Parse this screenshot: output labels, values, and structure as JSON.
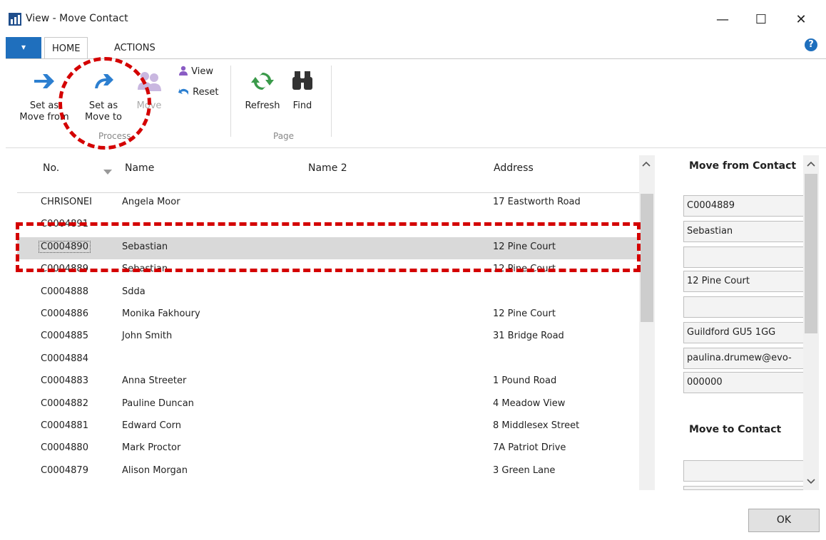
{
  "window": {
    "title": "View - Move Contact",
    "minimize_glyph": "—",
    "maximize_glyph": "☐",
    "close_glyph": "✕"
  },
  "ribbon": {
    "file_tab_glyph": "▾",
    "tabs": [
      {
        "label": "HOME"
      },
      {
        "label": "ACTIONS"
      }
    ],
    "help_glyph": "?",
    "buttons": {
      "set_move_from": "Set as\nMove from",
      "set_move_to": "Set as\nMove to",
      "move": "Move",
      "view": "View",
      "reset": "Reset",
      "refresh": "Refresh",
      "find": "Find"
    },
    "groups": {
      "process": "Process",
      "page": "Page"
    }
  },
  "grid": {
    "columns": [
      "No.",
      "Name",
      "Name 2",
      "Address"
    ],
    "rows": [
      {
        "no": "CHRISONEI",
        "name": "Angela Moor",
        "addr": "17 Eastworth Road"
      },
      {
        "no": "C0004891",
        "name": "",
        "addr": ""
      },
      {
        "no": "C0004890",
        "name": "Sebastian",
        "addr": "12 Pine Court"
      },
      {
        "no": "C0004889",
        "name": "Sebastian",
        "addr": "12 Pine Court"
      },
      {
        "no": "C0004888",
        "name": "Sdda",
        "addr": ""
      },
      {
        "no": "C0004886",
        "name": "Monika Fakhoury",
        "addr": "12 Pine Court"
      },
      {
        "no": "C0004885",
        "name": "John Smith",
        "addr": "31 Bridge Road"
      },
      {
        "no": "C0004884",
        "name": "",
        "addr": ""
      },
      {
        "no": "C0004883",
        "name": "Anna Streeter",
        "addr": "1 Pound Road"
      },
      {
        "no": "C0004882",
        "name": "Pauline Duncan",
        "addr": "4 Meadow View"
      },
      {
        "no": "C0004881",
        "name": "Edward Corn",
        "addr": "8 Middlesex Street"
      },
      {
        "no": "C0004880",
        "name": "Mark Proctor",
        "addr": "7A Patriot Drive"
      },
      {
        "no": "C0004879",
        "name": "Alison Morgan",
        "addr": "3 Green Lane"
      }
    ],
    "selected_index": 2
  },
  "move_from": {
    "title": "Move from Contact",
    "fields": [
      "C0004889",
      "Sebastian",
      "",
      "12 Pine Court",
      "",
      "Guildford GU5 1GG",
      "paulina.drumew@evo-",
      "000000"
    ]
  },
  "move_to": {
    "title": "Move to Contact",
    "fields": [
      "",
      ""
    ]
  },
  "ok_label": "OK",
  "colors": {
    "accent": "#1f6fbd",
    "annotation": "#d40000",
    "selected_row": "#d9d9d9"
  }
}
